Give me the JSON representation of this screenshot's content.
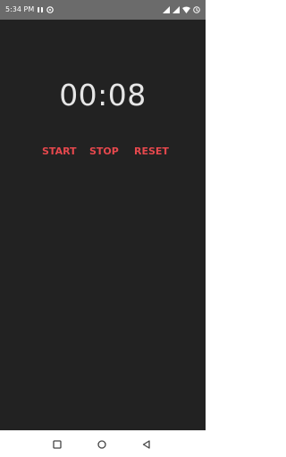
{
  "status_bar": {
    "time": "5:34 PM",
    "icons": [
      "app-notification-icon",
      "settings-notification-icon",
      "signal-icon",
      "signal-icon-2",
      "wifi-icon",
      "battery-icon"
    ]
  },
  "timer": {
    "display": "00:08"
  },
  "controls": {
    "start_label": "START",
    "stop_label": "STOP",
    "reset_label": "RESET"
  },
  "colors": {
    "background": "#222222",
    "accent": "#e5484d",
    "timer_text": "#e6e6e6",
    "status_bar": "#6b6b6b"
  },
  "nav_bar": {
    "buttons": [
      "recents-icon",
      "home-icon",
      "back-icon"
    ]
  }
}
